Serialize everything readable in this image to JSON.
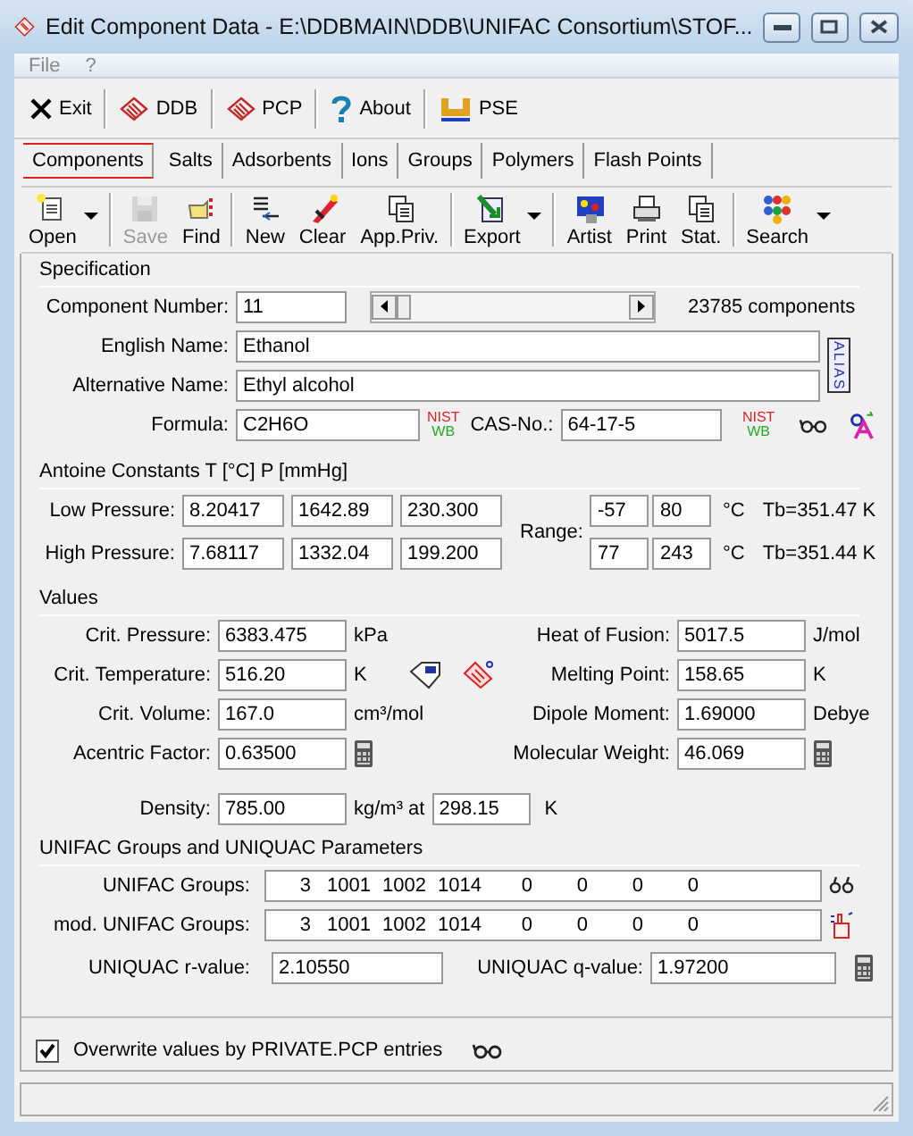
{
  "window": {
    "title": "Edit Component Data - E:\\DDBMAIN\\DDB\\UNIFAC Consortium\\STOF..."
  },
  "menu": [
    {
      "label": "File",
      "disabled": true
    },
    {
      "label": "?",
      "disabled": true
    }
  ],
  "main_toolbar": [
    {
      "label": "Exit"
    },
    {
      "label": "DDB"
    },
    {
      "label": "PCP"
    },
    {
      "label": "About"
    },
    {
      "label": "PSE"
    }
  ],
  "tabs": [
    {
      "label": "Components",
      "selected": true
    },
    {
      "label": "Salts",
      "selected": false
    },
    {
      "label": "Adsorbents",
      "selected": false
    },
    {
      "label": "Ions",
      "selected": false
    },
    {
      "label": "Groups",
      "selected": false
    },
    {
      "label": "Polymers",
      "selected": false
    },
    {
      "label": "Flash Points",
      "selected": false
    }
  ],
  "toolbar": [
    {
      "label": "Open",
      "disabled": false,
      "dropdown": true
    },
    {
      "label": "Save",
      "disabled": true,
      "dropdown": false
    },
    {
      "label": "Find",
      "disabled": false,
      "dropdown": false
    },
    {
      "label": "New",
      "disabled": false,
      "dropdown": false
    },
    {
      "label": "Clear",
      "disabled": false,
      "dropdown": false
    },
    {
      "label": "App.Priv.",
      "disabled": false,
      "dropdown": false
    },
    {
      "label": "Export",
      "disabled": false,
      "dropdown": true
    },
    {
      "label": "Artist",
      "disabled": false,
      "dropdown": false
    },
    {
      "label": "Print",
      "disabled": false,
      "dropdown": false
    },
    {
      "label": "Stat.",
      "disabled": false,
      "dropdown": false
    },
    {
      "label": "Search",
      "disabled": false,
      "dropdown": true
    }
  ],
  "specification": {
    "title": "Specification",
    "component_number": {
      "label": "Component Number:",
      "value": "11"
    },
    "count": "23785 components",
    "english_name": {
      "label": "English Name:",
      "value": "Ethanol"
    },
    "alias_icon": "ALIAS",
    "alternative_name": {
      "label": "Alternative Name:",
      "value": "Ethyl alcohol"
    },
    "formula": {
      "label": "Formula:",
      "value": "C2H6O"
    },
    "formula_nist": [
      "NIST",
      "WB"
    ],
    "cas": {
      "label": "CAS-No.:",
      "value": "64-17-5"
    },
    "cas_nist": [
      "NIST",
      "WB"
    ]
  },
  "antoine": {
    "title": "Antoine Constants  T [°C]  P [mmHg]",
    "range_label": "Range:",
    "rows": [
      {
        "label": "Low Pressure:",
        "a": "8.20417",
        "b": "1642.89",
        "c": "230.300",
        "t_min": "-57",
        "t_max": "80",
        "unit": "°C",
        "tb": "Tb=351.47 K"
      },
      {
        "label": "High Pressure:",
        "a": "7.68117",
        "b": "1332.04",
        "c": "199.200",
        "t_min": "77",
        "t_max": "243",
        "unit": "°C",
        "tb": "Tb=351.44 K"
      }
    ]
  },
  "values": {
    "title": "Values",
    "left": [
      {
        "kind": "unit",
        "label": "Crit. Pressure:",
        "value": "6383.475",
        "unit": "kPa"
      },
      {
        "kind": "reference",
        "label": "Crit. Temperature:",
        "value": "516.20",
        "unit": "K"
      },
      {
        "kind": "unit",
        "label": "Crit. Volume:",
        "value": "167.0",
        "unit": "cm³/mol"
      },
      {
        "kind": "calculated",
        "label": "Acentric Factor:",
        "value": "0.63500"
      }
    ],
    "right": [
      {
        "kind": "unit",
        "label": "Heat of Fusion:",
        "value": "5017.5",
        "unit": "J/mol"
      },
      {
        "kind": "unit",
        "label": "Melting Point:",
        "value": "158.65",
        "unit": "K"
      },
      {
        "kind": "unit",
        "label": "Dipole Moment:",
        "value": "1.69000",
        "unit": "Debye"
      },
      {
        "kind": "calculated",
        "label": "Molecular Weight:",
        "value": "46.069"
      }
    ],
    "density": {
      "label": "Density:",
      "value": "785.00",
      "unit": "kg/m³ at",
      "temperature": "298.15",
      "temperature_unit": "K"
    }
  },
  "unifac": {
    "title": "UNIFAC Groups and UNIQUAC Parameters",
    "groups": [
      {
        "label": "UNIFAC Groups:",
        "values": [
          "3",
          "1001",
          "1002",
          "1014",
          "0",
          "0",
          "0",
          "0"
        ]
      },
      {
        "label": "mod. UNIFAC Groups:",
        "values": [
          "3",
          "1001",
          "1002",
          "1014",
          "0",
          "0",
          "0",
          "0"
        ]
      }
    ],
    "r_value": {
      "label": "UNIQUAC r-value:",
      "value": "2.10550"
    },
    "q_value": {
      "label": "UNIQUAC q-value:",
      "value": "1.97200"
    }
  },
  "overwrite": {
    "label": "Overwrite values by PRIVATE.PCP entries",
    "checked": true
  }
}
